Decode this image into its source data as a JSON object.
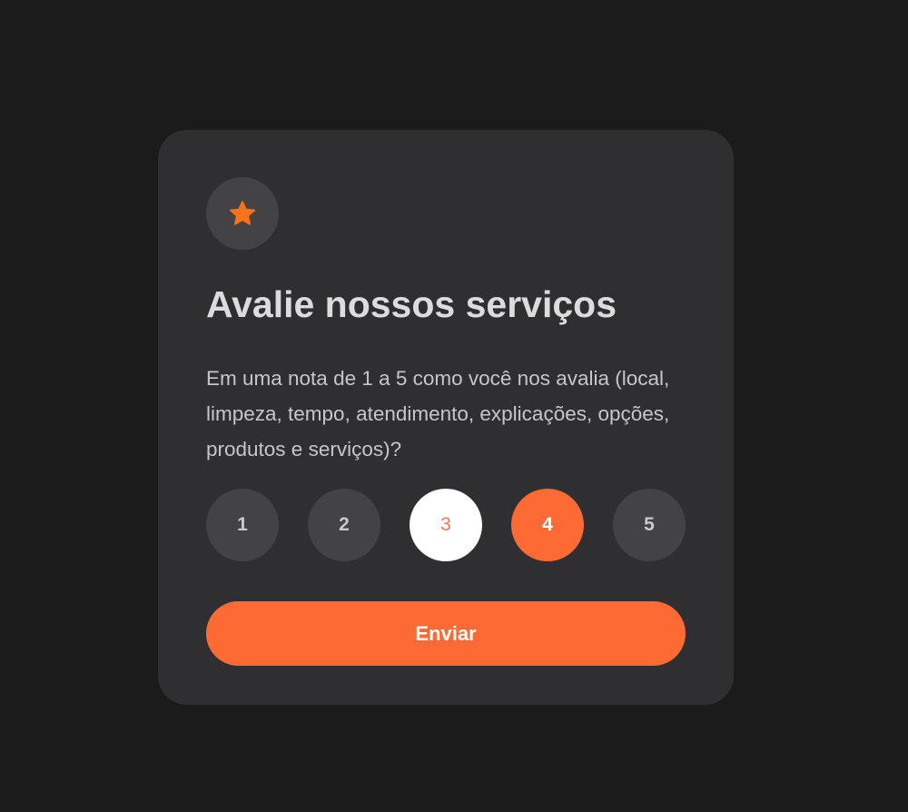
{
  "card": {
    "icon": "star-icon",
    "title": "Avalie nossos serviços",
    "description": "Em uma nota de 1 a 5 como você nos avalia (local, limpeza, tempo, atendimento, explicações, opções, produtos e serviços)?"
  },
  "rating": {
    "options": [
      "1",
      "2",
      "3",
      "4",
      "5"
    ],
    "selected": "4",
    "hovered": "3"
  },
  "submit": {
    "label": "Enviar"
  },
  "colors": {
    "background": "#1b1b1b",
    "card": "#2f2f31",
    "accent": "#fd6a34",
    "button": "#434346",
    "star": "#fb7316"
  }
}
